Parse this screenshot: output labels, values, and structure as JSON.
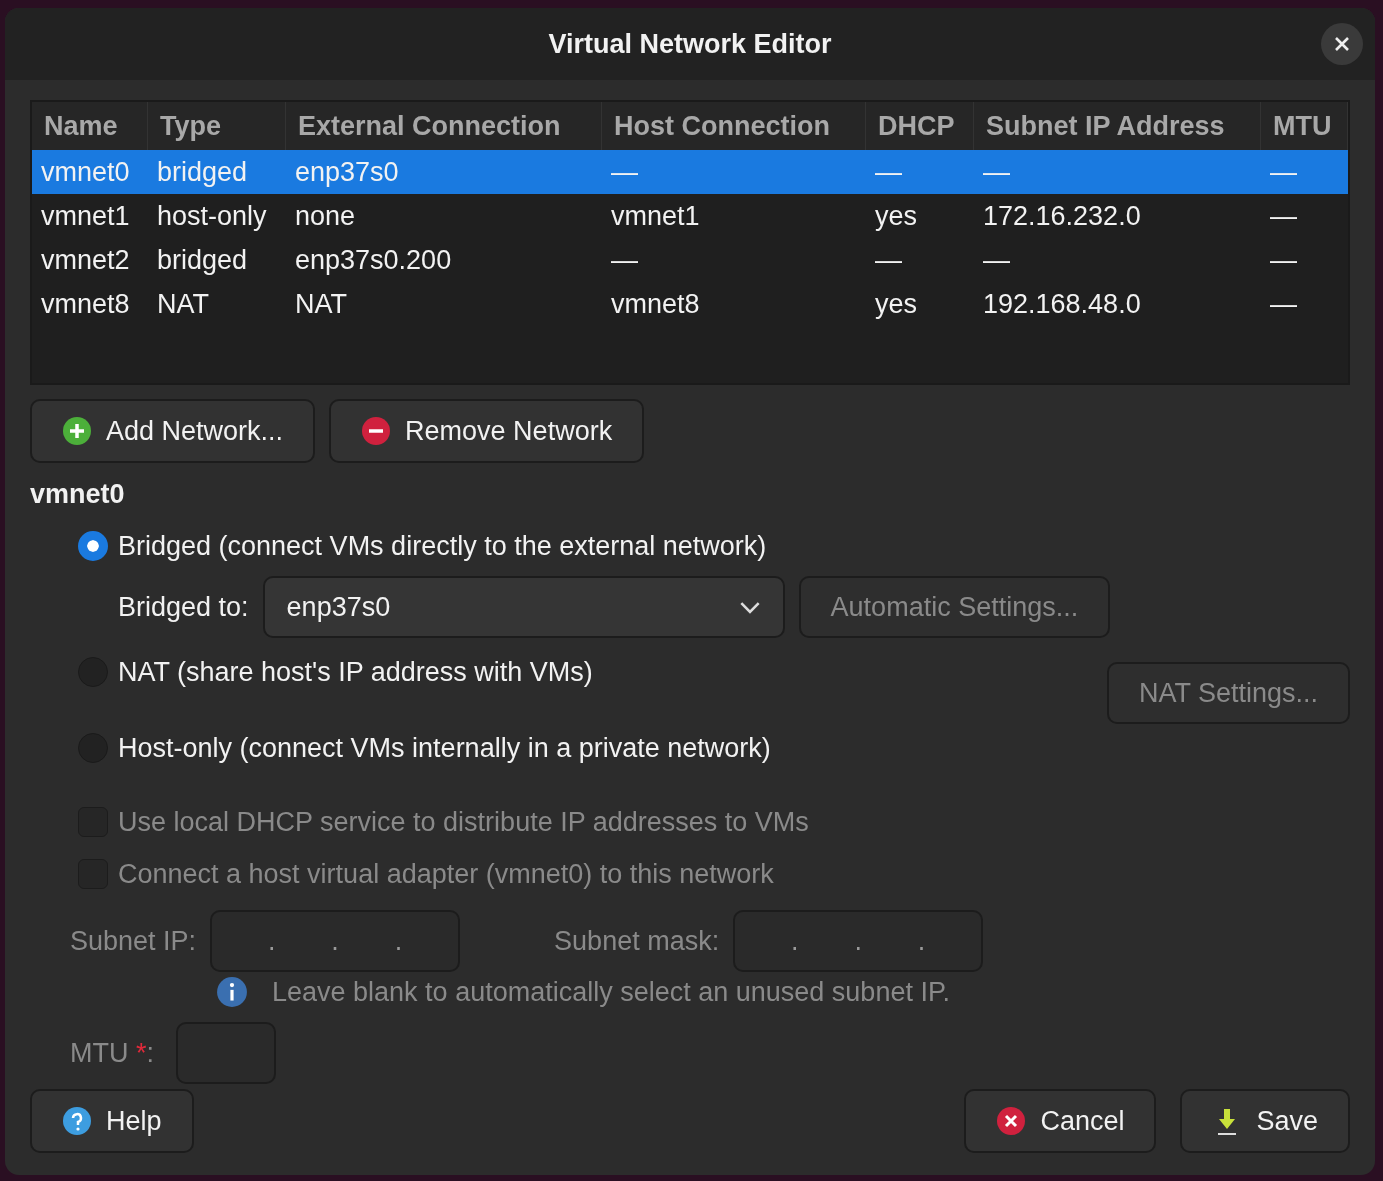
{
  "window": {
    "title": "Virtual Network Editor"
  },
  "table": {
    "columns": [
      "Name",
      "Type",
      "External Connection",
      "Host Connection",
      "DHCP",
      "Subnet IP Address",
      "MTU"
    ],
    "rows": [
      {
        "cells": [
          "vmnet0",
          "bridged",
          "enp37s0",
          "—",
          "—",
          "—",
          "—"
        ],
        "selected": true
      },
      {
        "cells": [
          "vmnet1",
          "host-only",
          "none",
          "vmnet1",
          "yes",
          "172.16.232.0",
          "—"
        ],
        "selected": false
      },
      {
        "cells": [
          "vmnet2",
          "bridged",
          "enp37s0.200",
          "—",
          "—",
          "—",
          "—"
        ],
        "selected": false
      },
      {
        "cells": [
          "vmnet8",
          "NAT",
          "NAT",
          "vmnet8",
          "yes",
          "192.168.48.0",
          "—"
        ],
        "selected": false
      }
    ]
  },
  "network_buttons": [
    {
      "label": "Add Network...",
      "kind": "add"
    },
    {
      "label": "Remove Network",
      "kind": "remove"
    }
  ],
  "section_title": "vmnet0",
  "modes": [
    {
      "label": "Bridged (connect VMs directly to the external network)",
      "selected": true,
      "kind": "bridged"
    },
    {
      "label": "NAT (share host's IP address with VMs)",
      "selected": false,
      "kind": "nat"
    },
    {
      "label": "Host-only (connect VMs internally in a private network)",
      "selected": false,
      "kind": "hostonly"
    }
  ],
  "bridged_to": {
    "label": "Bridged to:",
    "value": "enp37s0"
  },
  "automatic_settings": {
    "label": "Automatic Settings...",
    "disabled": true
  },
  "nat_settings": {
    "label": "NAT Settings...",
    "disabled": true
  },
  "options": [
    {
      "label": "Use local DHCP service to distribute IP addresses to VMs",
      "checked": false,
      "disabled": true
    },
    {
      "label": "Connect a host virtual adapter (vmnet0) to this network",
      "checked": false,
      "disabled": true
    }
  ],
  "subnet_ip": {
    "label": "Subnet IP:",
    "dots": [
      ".",
      ".",
      "."
    ]
  },
  "subnet_mask": {
    "label": "Subnet mask:",
    "dots": [
      ".",
      ".",
      "."
    ]
  },
  "hint": "Leave blank to automatically select an unused subnet IP.",
  "mtu": {
    "label": "MTU",
    "required_mark": "*",
    "label_end": ":"
  },
  "footer_buttons": [
    {
      "label": "Help",
      "kind": "help"
    },
    {
      "label": "Cancel",
      "kind": "cancel"
    },
    {
      "label": "Save",
      "kind": "save"
    }
  ]
}
